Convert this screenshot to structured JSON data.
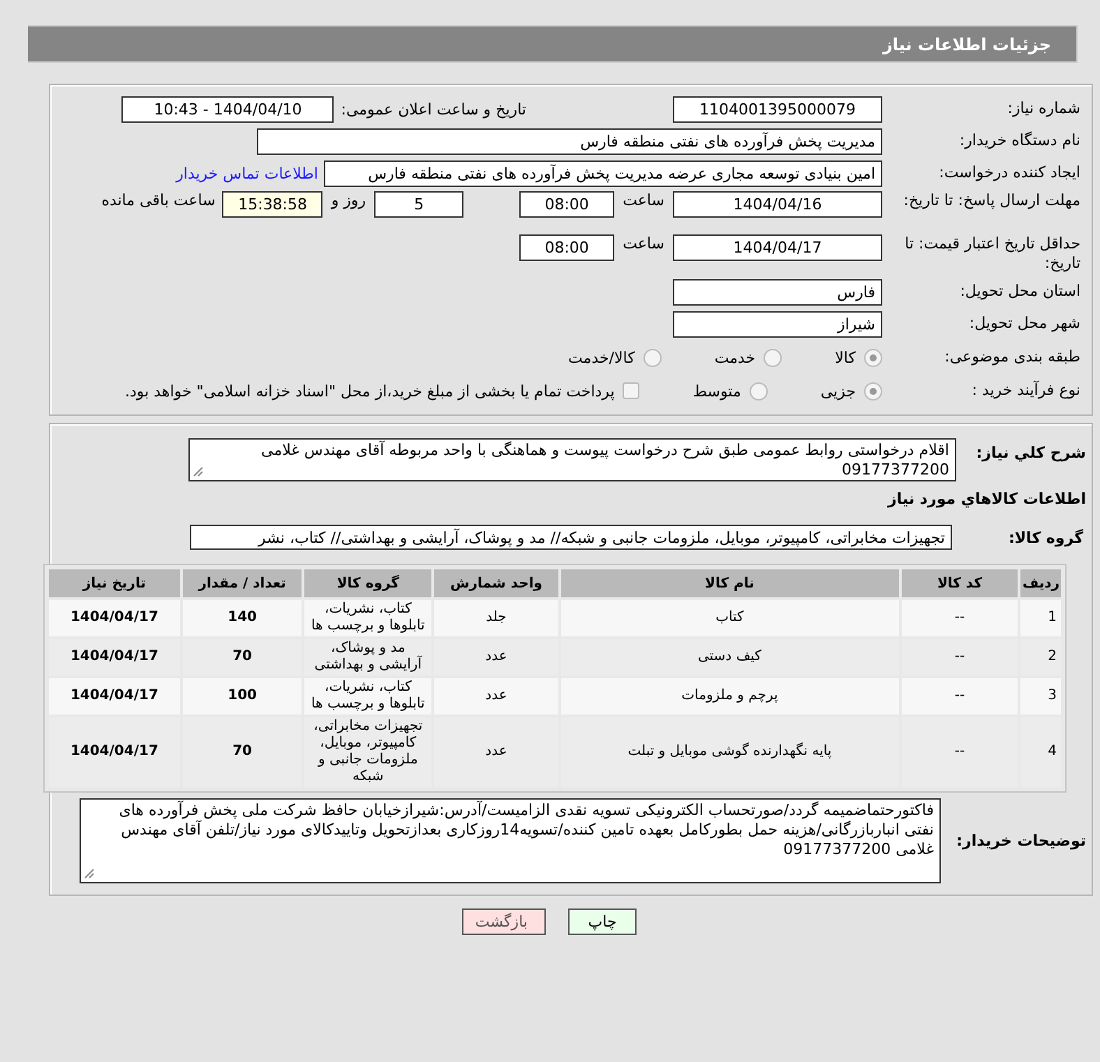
{
  "header": {
    "title": "جزئیات اطلاعات نیاز"
  },
  "need": {
    "need_number": {
      "label": "شماره نیاز:",
      "value": "1104001395000079"
    },
    "announce": {
      "label": "تاریخ و ساعت اعلان عمومی:",
      "value": "1404/04/10 - 10:43"
    },
    "buyer_org": {
      "label": "نام دستگاه خریدار:",
      "value": "مدیریت پخش فرآورده های نفتی منطقه فارس"
    },
    "requester": {
      "label": "ایجاد کننده درخواست:",
      "value": "امین بنیادی توسعه مجاری عرضه مدیریت پخش فرآورده های نفتی منطقه فارس",
      "link": "اطلاعات تماس خریدار"
    },
    "response_deadline": {
      "label": "مهلت ارسال پاسخ: تا تاریخ:",
      "date": "1404/04/16",
      "time_label": "ساعت",
      "time": "08:00",
      "days": "5",
      "days_label": "روز و",
      "remaining": "15:38:58",
      "remaining_label": "ساعت باقی مانده"
    },
    "price_validity": {
      "label": "حداقل تاریخ اعتبار قیمت: تا تاریخ:",
      "date": "1404/04/17",
      "time_label": "ساعت",
      "time": "08:00"
    },
    "province": {
      "label": "استان محل تحویل:",
      "value": "فارس"
    },
    "city": {
      "label": "شهر محل تحویل:",
      "value": "شیراز"
    },
    "category": {
      "label": "طبقه بندی موضوعی:",
      "options": [
        {
          "label": "کالا",
          "selected": true
        },
        {
          "label": "خدمت",
          "selected": false
        },
        {
          "label": "کالا/خدمت",
          "selected": false
        }
      ]
    },
    "process": {
      "label": "نوع فرآیند خرید :",
      "options": [
        {
          "label": "جزیی",
          "selected": true
        },
        {
          "label": "متوسط",
          "selected": false
        }
      ],
      "payment": {
        "label": "پرداخت تمام یا بخشی از مبلغ خرید،از محل \"اسناد خزانه اسلامی\" خواهد بود.",
        "checked": false
      }
    }
  },
  "description": {
    "label": "شرح کلي نیاز:",
    "value": "اقلام درخواستی روابط عمومی طبق شرح درخواست پیوست و هماهنگی با واحد مربوطه آقای مهندس غلامی 09177377200"
  },
  "goods": {
    "title": "اطلاعات کالاهاي مورد نیاز",
    "group_label": "گروه کالا:",
    "group_value": "تجهیزات مخابراتی، کامپیوتر، موبایل، ملزومات جانبی و شبکه// مد و پوشاک، آرایشی و بهداشتی// کتاب، نشر",
    "table": {
      "columns": [
        "ردیف",
        "کد کالا",
        "نام کالا",
        "واحد شمارش",
        "گروه کالا",
        "تعداد / مقدار",
        "تاریخ نیاز"
      ],
      "rows": [
        [
          "1",
          "--",
          "کتاب",
          "جلد",
          "کتاب، نشریات، تابلوها و برچسب ها",
          "140",
          "1404/04/17"
        ],
        [
          "2",
          "--",
          "کیف دستی",
          "عدد",
          "مد و پوشاک، آرایشی و بهداشتی",
          "70",
          "1404/04/17"
        ],
        [
          "3",
          "--",
          "پرچم و ملزومات",
          "عدد",
          "کتاب، نشریات، تابلوها و برچسب ها",
          "100",
          "1404/04/17"
        ],
        [
          "4",
          "--",
          "پایه نگهدارنده گوشی موبایل و تبلت",
          "عدد",
          "تجهیزات مخابراتی، کامپیوتر، موبایل، ملزومات جانبی و شبکه",
          "70",
          "1404/04/17"
        ]
      ]
    }
  },
  "buyer_notes": {
    "label": "توضیحات خریدار:",
    "value": "فاکتورحتماضمیمه گردد/صورتحساب الکترونیکی تسویه نقدی الزامیست/آدرس:شیرازخیابان حافظ شرکت ملی پخش فرآورده های نفتی انباربازرگانی/هزینه حمل بطورکامل بعهده تامین کننده/تسویه14روزکاری بعدازتحویل وتاییدکالای مورد نیاز/تلفن آقای مهندس غلامی 09177377200"
  },
  "buttons": [
    {
      "label": "چاپ",
      "kind": "print"
    },
    {
      "label": "بازگشت",
      "kind": "back"
    }
  ]
}
